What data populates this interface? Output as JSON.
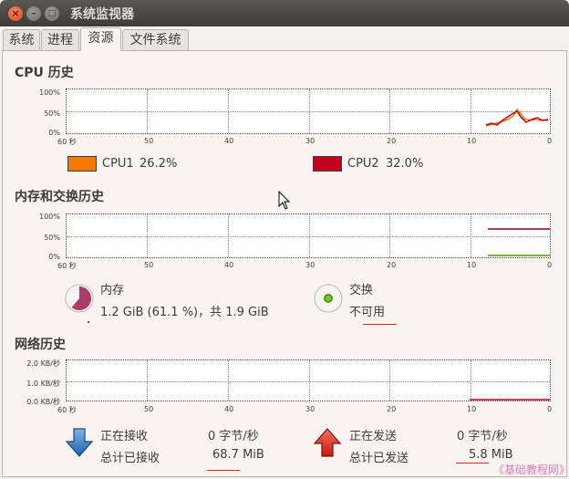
{
  "window": {
    "title": "系统监视器"
  },
  "tabs": [
    {
      "label": "系统"
    },
    {
      "label": "进程"
    },
    {
      "label": "资源"
    },
    {
      "label": "文件系统"
    }
  ],
  "cpu": {
    "title": "CPU 历史",
    "y_labels": [
      "100%",
      "50%",
      "0%"
    ],
    "x_labels": [
      "60 秒",
      "50",
      "40",
      "30",
      "20",
      "10",
      "0"
    ],
    "cpu1": {
      "label": "CPU1",
      "value": "26.2%",
      "color": "#f57900"
    },
    "cpu2": {
      "label": "CPU2",
      "value": "32.0%",
      "color": "#c4001f"
    }
  },
  "memory": {
    "title": "内存和交换历史",
    "y_labels": [
      "100%",
      "50%",
      "0%"
    ],
    "x_labels": [
      "60 秒",
      "50",
      "40",
      "30",
      "20",
      "10",
      "0"
    ],
    "mem_label": "内存",
    "mem_value": "1.2 GiB (61.1 %)，共 1.9 GiB",
    "mem_fraction": 0.611,
    "mem_color": "#ad3b6a",
    "swap_label": "交换",
    "swap_value": "不可用",
    "swap_color": "#4e9a06"
  },
  "network": {
    "title": "网络历史",
    "y_labels": [
      "2.0 KB/秒",
      "1.0 KB/秒",
      "0.0 KB/秒"
    ],
    "x_labels": [
      "60 秒",
      "50",
      "40",
      "30",
      "20",
      "10",
      "0"
    ],
    "recv_label": "正在接收",
    "recv_rate": "0 字节/秒",
    "recv_total_label": "总计已接收",
    "recv_total": "68.7 MiB",
    "send_label": "正在发送",
    "send_rate": "0 字节/秒",
    "send_total_label": "总计已发送",
    "send_total": "5.8 MiB"
  },
  "watermark": "《基础教程网》"
}
